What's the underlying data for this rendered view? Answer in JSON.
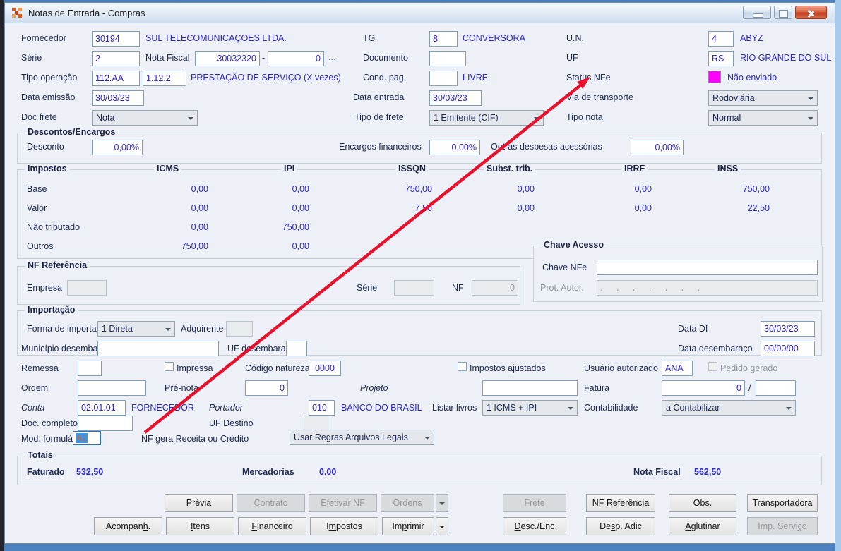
{
  "window": {
    "title": "Notas de Entrada - Compras"
  },
  "fields": {
    "fornecedor": {
      "label": "Fornecedor",
      "value": "30194",
      "desc": "SUL TELECOMUNICAÇOES LTDA."
    },
    "tg": {
      "label": "TG",
      "value": "8",
      "desc": "CONVERSORA"
    },
    "un": {
      "label": "U.N.",
      "value": "4",
      "desc": "ABYZ"
    },
    "serie": {
      "label": "Série",
      "value": "2"
    },
    "nota_fiscal": {
      "label": "Nota Fiscal",
      "value": "30032320",
      "dash": "-",
      "value2": "0",
      "more": "..."
    },
    "documento": {
      "label": "Documento",
      "value": ""
    },
    "uf": {
      "label": "UF",
      "value": "RS",
      "desc": "RIO GRANDE DO SUL"
    },
    "tipo_operacao": {
      "label": "Tipo operação",
      "value": "112.AA",
      "value2": "1.12.2",
      "desc": "PRESTAÇÃO DE SERVIÇO (X vezes)"
    },
    "cond_pag": {
      "label": "Cond. pag.",
      "value": "",
      "desc": "LIVRE"
    },
    "status_nfe": {
      "label": "Status NFe",
      "desc": "Não enviado",
      "color": "#ff00ff"
    },
    "data_emissao": {
      "label": "Data emissão",
      "value": "30/03/23"
    },
    "data_entrada": {
      "label": "Data entrada",
      "value": "30/03/23"
    },
    "via_transporte": {
      "label": "Via de transporte",
      "value": "Rodoviária"
    },
    "doc_frete": {
      "label": "Doc frete",
      "value": "Nota"
    },
    "tipo_frete": {
      "label": "Tipo de frete",
      "value": "1 Emitente (CIF)"
    },
    "tipo_nota": {
      "label": "Tipo nota",
      "value": "Normal"
    }
  },
  "descontos": {
    "legend": "Descontos/Encargos",
    "desconto_label": "Desconto",
    "desconto": "0,00%",
    "encargos_label": "Encargos financeiros",
    "encargos": "0,00%",
    "outras_label": "Outras despesas acessórias",
    "outras": "0,00%"
  },
  "impostos": {
    "legend": "Impostos",
    "columns": [
      "ICMS",
      "IPI",
      "ISSQN",
      "Subst. trib.",
      "IRRF",
      "INSS"
    ],
    "rows": [
      {
        "label": "Base",
        "values": [
          "0,00",
          "0,00",
          "750,00",
          "0,00",
          "0,00",
          "750,00"
        ]
      },
      {
        "label": "Valor",
        "values": [
          "0,00",
          "0,00",
          "7,50",
          "0,00",
          "0,00",
          "22,50"
        ]
      },
      {
        "label": "Não tributado",
        "values": [
          "0,00",
          "750,00",
          "",
          "",
          "",
          ""
        ]
      },
      {
        "label": "Outros",
        "values": [
          "750,00",
          "0,00",
          "",
          "",
          "",
          ""
        ]
      }
    ]
  },
  "chave": {
    "legend": "Chave Acesso",
    "chave_label": "Chave NFe",
    "chave_value": "",
    "prot_label": "Prot. Autor.",
    "prot_value": ". . . . . . ."
  },
  "nfref": {
    "legend": "NF Referência",
    "empresa_label": "Empresa",
    "empresa_value": "",
    "serie_label": "Série",
    "serie_value": "",
    "nf_label": "NF",
    "nf_value": "0"
  },
  "importacao": {
    "legend": "Importação",
    "forma_label": "Forma de importação",
    "forma": "1 Direta",
    "adquirente_label": "Adquirente",
    "adquirente": "",
    "data_di_label": "Data DI",
    "data_di": "30/03/23",
    "municipio_label": "Município desembaraço",
    "municipio": "",
    "uf_label": "UF desembaraço",
    "uf": "",
    "data_desemb_label": "Data desembaraço",
    "data_desemb": "00/00/00"
  },
  "det": {
    "remessa_label": "Remessa",
    "remessa": "",
    "impressa_label": "Impressa",
    "cod_natureza_label": "Código natureza",
    "cod_natureza": "0000",
    "impostos_ajustados_label": "Impostos ajustados",
    "usuario_label": "Usuário autorizado",
    "usuario": "ANA",
    "pedido_gerado_label": "Pedido gerado",
    "ordem_label": "Ordem",
    "ordem": "",
    "pre_nota_label": "Pré-nota",
    "pre_nota": "0",
    "projeto_label": "Projeto",
    "projeto": "",
    "fatura_label": "Fatura",
    "fatura": "0",
    "fatura_sep": "/",
    "fatura2": "",
    "conta_label": "Conta",
    "conta": "02.01.01",
    "conta_desc": "FORNECEDOR",
    "portador_label": "Portador",
    "portador": "010",
    "portador_desc": "BANCO DO BRASIL",
    "listar_label": "Listar livros",
    "listar": "1 ICMS + IPI",
    "contab_label": "Contabilidade",
    "contab": "a Contabilizar",
    "doc_completo_label": "Doc. completo",
    "doc_completo": "",
    "uf_destino_label": "UF Destino",
    "uf_destino": "",
    "mod_form_label": "Mod. formulário",
    "mod_form": "62",
    "nf_gera_label": "NF gera Receita ou Crédito",
    "nf_gera": "Usar Regras Arquivos Legais"
  },
  "totais": {
    "legend": "Totais",
    "faturado_label": "Faturado",
    "faturado": "532,50",
    "mercadorias_label": "Mercadorias",
    "mercadorias": "0,00",
    "nota_fiscal_label": "Nota Fiscal",
    "nota_fiscal": "562,50"
  },
  "buttons": {
    "previa": {
      "pre": "Pré",
      "mn": "v",
      "post": "ia"
    },
    "contrato": {
      "pre": "",
      "mn": "C",
      "post": "ontrato"
    },
    "efetivar": {
      "pre": "Efetivar ",
      "mn": "N",
      "post": "F"
    },
    "ordens": {
      "pre": "",
      "mn": "O",
      "post": "rdens"
    },
    "frete": {
      "pre": "Fre",
      "mn": "t",
      "post": "e"
    },
    "nf_ref": {
      "pre": "NF ",
      "mn": "R",
      "post": "eferência"
    },
    "obs": {
      "pre": "O",
      "mn": "b",
      "post": "s."
    },
    "transportadora": {
      "pre": "",
      "mn": "T",
      "post": "ransportadora"
    },
    "acompanh": {
      "pre": "Acompan",
      "mn": "h",
      "post": "."
    },
    "itens": {
      "pre": "",
      "mn": "I",
      "post": "tens"
    },
    "financeiro": {
      "pre": "",
      "mn": "F",
      "post": "inanceiro"
    },
    "impostos": {
      "pre": "I",
      "mn": "m",
      "post": "postos"
    },
    "imprimir": {
      "pre": "Im",
      "mn": "p",
      "post": "rimir"
    },
    "desc_enc": {
      "pre": "",
      "mn": "D",
      "post": "esc./Enc"
    },
    "desp_adic": {
      "pre": "De",
      "mn": "s",
      "post": "p. Adic"
    },
    "aglutinar": {
      "pre": "",
      "mn": "A",
      "post": "glutinar"
    },
    "imp_servico": {
      "pre": "Imp. Servi",
      "mn": "ç",
      "post": "o"
    }
  },
  "colors": {
    "status_nfe_swatch": "#ff00ff",
    "annotation_arrow": "#e8112d"
  }
}
